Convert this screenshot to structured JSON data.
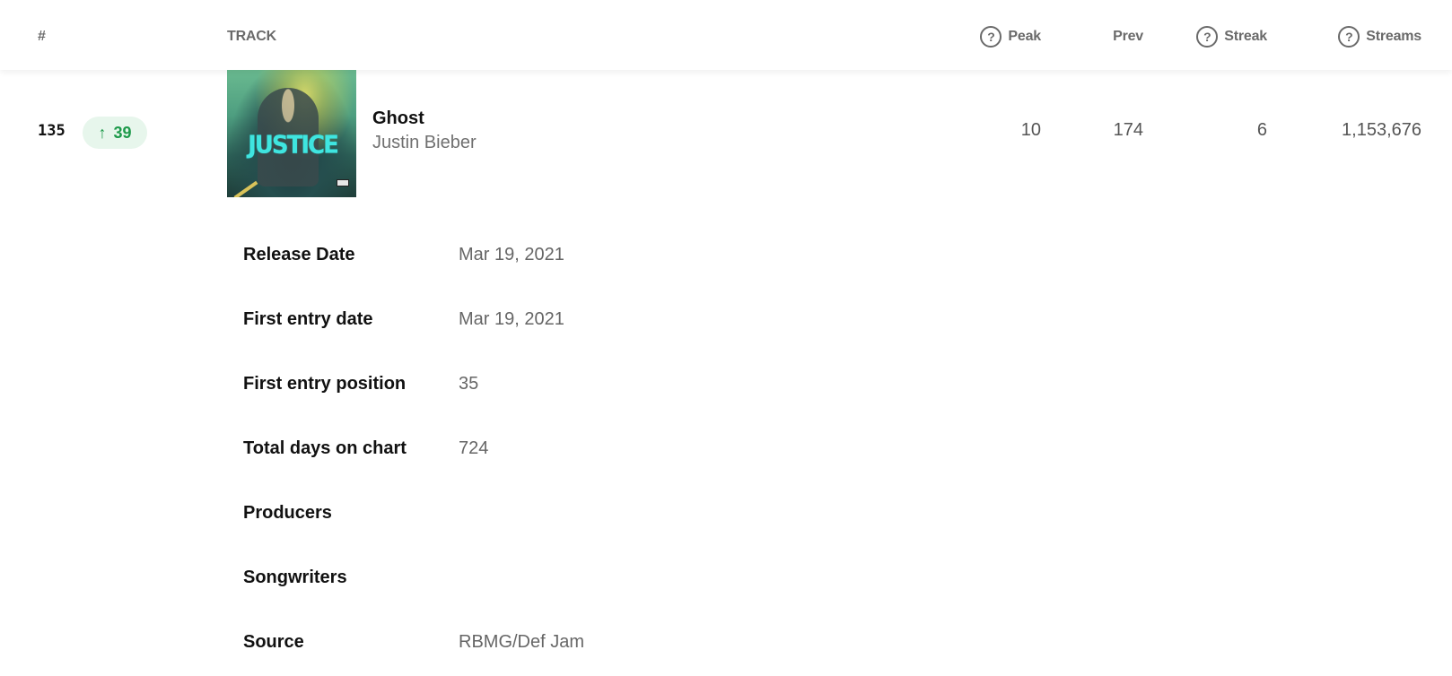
{
  "header": {
    "rank_label": "#",
    "track_label": "TRACK",
    "peak_label": "Peak",
    "prev_label": "Prev",
    "streak_label": "Streak",
    "streams_label": "Streams",
    "help_icon_glyph": "?"
  },
  "row": {
    "rank": "135",
    "change": {
      "direction": "up",
      "arrow_glyph": "↑",
      "value": "39",
      "color": "#1e9a4b",
      "background": "#e7f6ec"
    },
    "album_art": {
      "icon": "album-cover-image",
      "logo_text": "JUSTICE"
    },
    "title": "Ghost",
    "artist": "Justin Bieber",
    "peak": "10",
    "prev": "174",
    "streak": "6",
    "streams": "1,153,676"
  },
  "details": [
    {
      "label": "Release Date",
      "value": "Mar 19, 2021"
    },
    {
      "label": "First entry date",
      "value": "Mar 19, 2021"
    },
    {
      "label": "First entry position",
      "value": "35"
    },
    {
      "label": "Total days on chart",
      "value": "724"
    },
    {
      "label": "Producers",
      "value": ""
    },
    {
      "label": "Songwriters",
      "value": ""
    },
    {
      "label": "Source",
      "value": "RBMG/Def Jam"
    }
  ]
}
